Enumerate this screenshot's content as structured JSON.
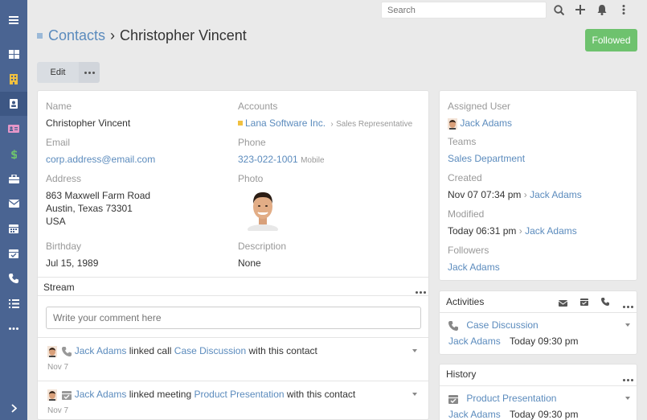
{
  "search": {
    "placeholder": "Search"
  },
  "header": {
    "scope": "Contacts",
    "separator": "›",
    "record": "Christopher Vincent"
  },
  "actions": {
    "followed": "Followed",
    "edit": "Edit"
  },
  "detail": {
    "name": {
      "label": "Name",
      "value": "Christopher Vincent"
    },
    "accounts": {
      "label": "Accounts",
      "value": "Lana Software Inc.",
      "arrow": "›",
      "role": "Sales Representative"
    },
    "email": {
      "label": "Email",
      "value": "corp.address@email.com"
    },
    "phone": {
      "label": "Phone",
      "value": "323-022-1001",
      "type": "Mobile"
    },
    "address": {
      "label": "Address",
      "line1": "863 Maxwell Farm Road",
      "line2": "Austin, Texas 73301",
      "line3": "USA"
    },
    "photo": {
      "label": "Photo"
    },
    "birthday": {
      "label": "Birthday",
      "value": "Jul 15, 1989"
    },
    "description": {
      "label": "Description",
      "value": "None"
    }
  },
  "stream": {
    "title": "Stream",
    "comment_placeholder": "Write your comment here",
    "entries": [
      {
        "user": "Jack Adams",
        "action": "linked call",
        "target": "Case Discussion",
        "suffix": "with this contact",
        "date": "Nov 7"
      },
      {
        "user": "Jack Adams",
        "action": "linked meeting",
        "target": "Product Presentation",
        "suffix": "with this contact",
        "date": "Nov 7"
      }
    ]
  },
  "side": {
    "assigned_user": {
      "label": "Assigned User",
      "value": "Jack Adams"
    },
    "teams": {
      "label": "Teams",
      "value": "Sales Department"
    },
    "created": {
      "label": "Created",
      "date": "Nov 07 07:34 pm",
      "arrow": "›",
      "user": "Jack Adams"
    },
    "modified": {
      "label": "Modified",
      "date": "Today 06:31 pm",
      "arrow": "›",
      "user": "Jack Adams"
    },
    "followers": {
      "label": "Followers",
      "value": "Jack Adams"
    }
  },
  "activities": {
    "title": "Activities",
    "item": {
      "name": "Case Discussion",
      "user": "Jack Adams",
      "time": "Today 09:30 pm"
    }
  },
  "history": {
    "title": "History",
    "item": {
      "name": "Product Presentation",
      "user": "Jack Adams",
      "time": "Today 09:30 pm"
    }
  },
  "colors": {
    "sidebar": "#4a6492",
    "link": "#5b8bbd",
    "followed": "#6ec26e",
    "account_marker": "#f0c040"
  }
}
